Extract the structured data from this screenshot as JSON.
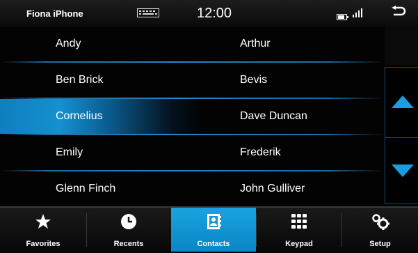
{
  "status": {
    "device_name": "Fiona iPhone",
    "time": "12:00"
  },
  "contacts": {
    "rows": [
      {
        "left": "Andy",
        "right": "Arthur"
      },
      {
        "left": "Ben Brick",
        "right": "Bevis"
      },
      {
        "left": "Cornelius",
        "right": "Dave Duncan"
      },
      {
        "left": "Emily",
        "right": "Frederik"
      },
      {
        "left": "Glenn Finch",
        "right": "John Gulliver"
      }
    ],
    "selected": "Cornelius"
  },
  "tabs": [
    {
      "label": "Favorites",
      "icon": "star-icon"
    },
    {
      "label": "Recents",
      "icon": "clock-icon"
    },
    {
      "label": "Contacts",
      "icon": "contact-book-icon",
      "active": true
    },
    {
      "label": "Keypad",
      "icon": "keypad-icon"
    },
    {
      "label": "Setup",
      "icon": "gears-icon"
    }
  ],
  "colors": {
    "accent": "#1aa3e0",
    "separator": "#2a86c2"
  }
}
